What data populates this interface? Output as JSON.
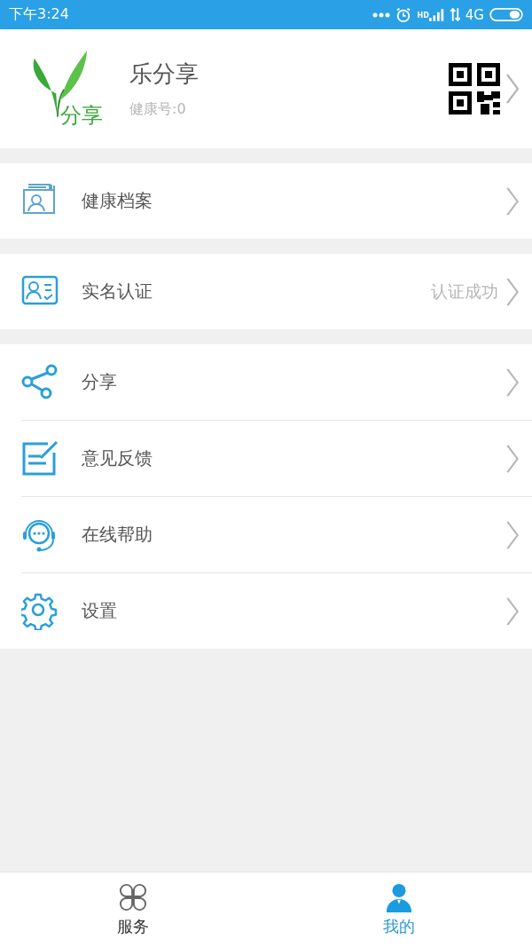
{
  "status_bar": {
    "time": "下午3:24",
    "signal_label": "HD",
    "network": "4G"
  },
  "profile": {
    "logo_text": "分享",
    "name": "乐分享",
    "health_id": "健康号:0"
  },
  "menu_groups": [
    {
      "items": [
        {
          "label": "健康档案"
        }
      ]
    },
    {
      "items": [
        {
          "label": "实名认证",
          "value": "认证成功"
        }
      ]
    },
    {
      "items": [
        {
          "label": "分享"
        },
        {
          "label": "意见反馈"
        },
        {
          "label": "在线帮助"
        },
        {
          "label": "设置"
        }
      ]
    }
  ],
  "bottom_nav": [
    {
      "label": "服务",
      "selected": false
    },
    {
      "label": "我的",
      "selected": true
    }
  ]
}
